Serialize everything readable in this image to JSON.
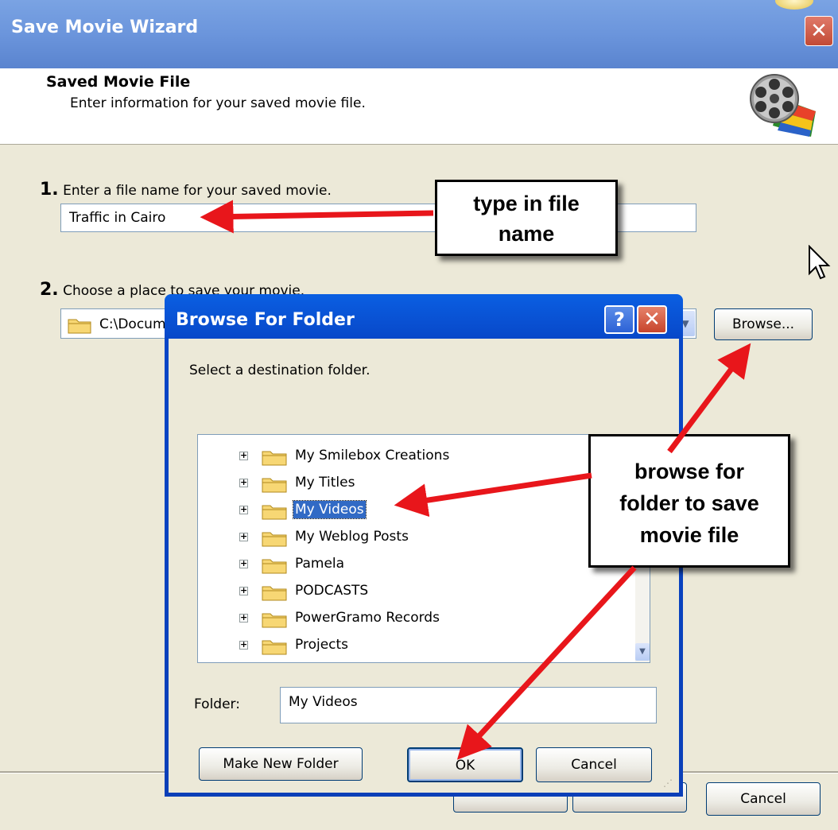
{
  "wizard": {
    "title": "Save Movie Wizard",
    "close_glyph": "✕",
    "header_title": "Saved Movie File",
    "header_subtitle": "Enter information for your saved movie file.",
    "step1_num": "1.",
    "step1_label": "Enter a file name for your saved movie.",
    "file_name_value": "Traffic in Cairo",
    "step2_num": "2.",
    "step2_label": "Choose a place to save your movie.",
    "save_path_value": "C:\\Docum",
    "browse_label": "Browse...",
    "cancel_label": "Cancel",
    "film_icon": "movie-reel-icon"
  },
  "dialog": {
    "title": "Browse For Folder",
    "help_glyph": "?",
    "close_glyph": "✕",
    "prompt": "Select a destination folder.",
    "tree_items": [
      {
        "label": "My Smilebox Creations",
        "selected": false
      },
      {
        "label": "My Titles",
        "selected": false
      },
      {
        "label": "My Videos",
        "selected": true
      },
      {
        "label": "My Weblog Posts",
        "selected": false
      },
      {
        "label": "Pamela",
        "selected": false
      },
      {
        "label": "PODCASTS",
        "selected": false
      },
      {
        "label": "PowerGramo Records",
        "selected": false
      },
      {
        "label": "Projects",
        "selected": false
      }
    ],
    "folder_label": "Folder:",
    "folder_value": "My Videos",
    "make_new_folder_label": "Make New Folder",
    "ok_label": "OK",
    "cancel_label": "Cancel"
  },
  "annotations": {
    "callout1_line1": "type in file",
    "callout1_line2": "name",
    "callout2_line1": "browse for",
    "callout2_line2": "folder to save",
    "callout2_line3": "movie file",
    "arrow_color": "#e8161b"
  }
}
